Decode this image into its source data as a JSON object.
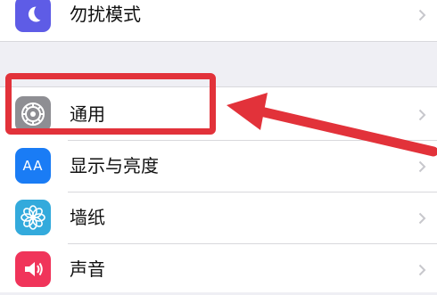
{
  "rows": [
    {
      "label": "勿扰模式",
      "icon": "moon-icon",
      "icon_color": "#5e5ce6"
    },
    {
      "label": "通用",
      "icon": "gear-icon",
      "icon_color": "#8e8e93"
    },
    {
      "label": "显示与亮度",
      "icon": "text-size-icon",
      "icon_color": "#1a7cf5",
      "icon_text": "AA"
    },
    {
      "label": "墙纸",
      "icon": "flower-icon",
      "icon_color": "#33aadc"
    },
    {
      "label": "声音",
      "icon": "speaker-icon",
      "icon_color": "#f0345a"
    }
  ],
  "annotation": {
    "color": "#e2323a",
    "highlighted_row": "通用"
  }
}
